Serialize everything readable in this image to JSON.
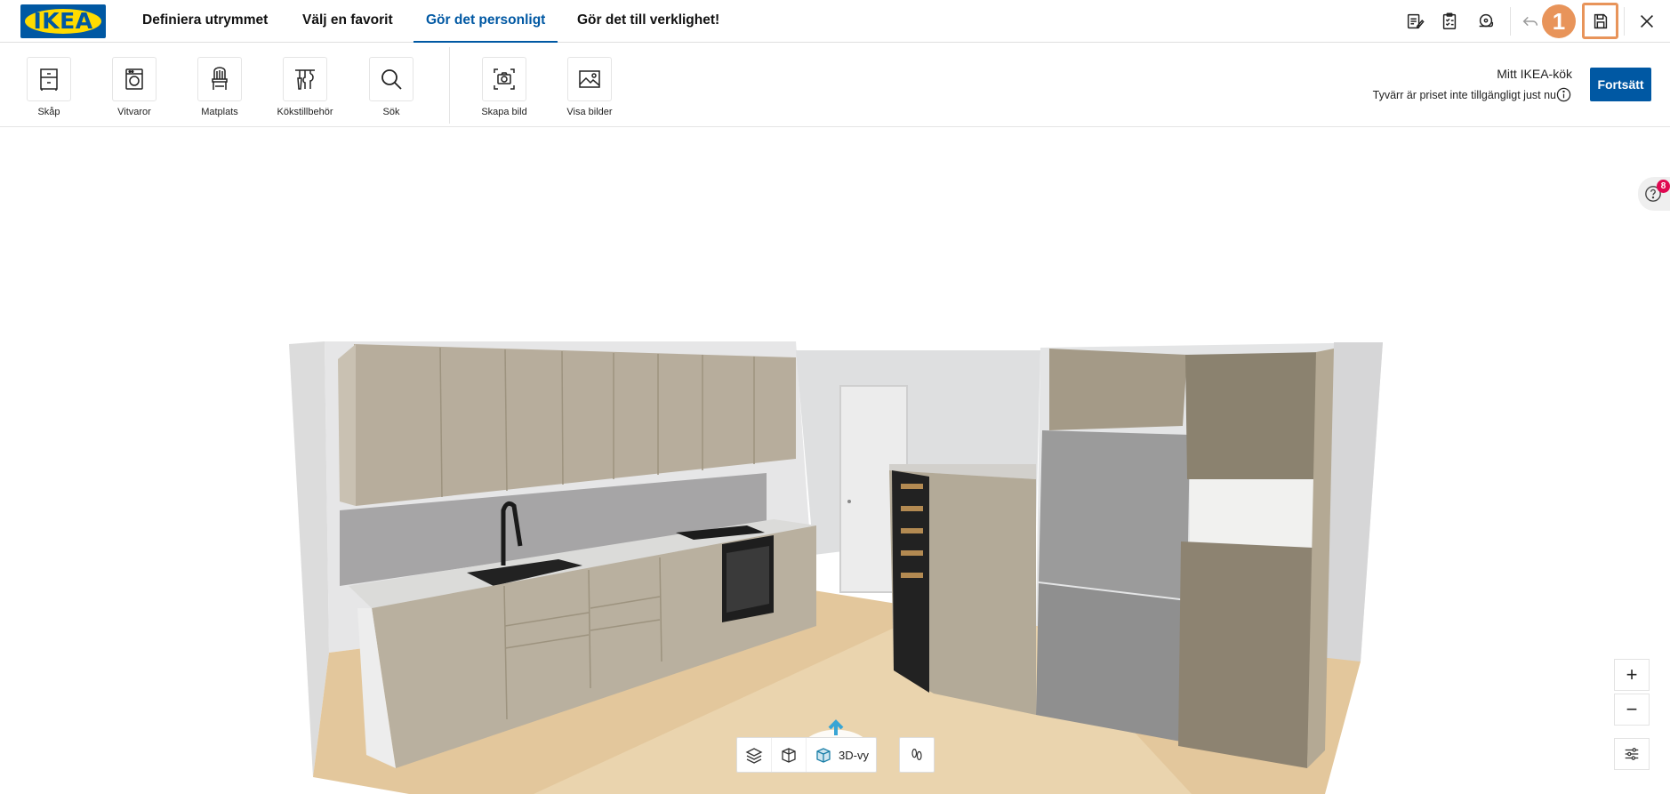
{
  "brand": {
    "logo_text": "IKEA",
    "blue": "#0058a3",
    "yellow": "#ffdb00"
  },
  "nav": {
    "tabs": [
      {
        "label": "Definiera utrymmet"
      },
      {
        "label": "Välj en favorit"
      },
      {
        "label": "Gör det personligt",
        "active": true
      },
      {
        "label": "Gör det till verklighet!"
      }
    ]
  },
  "top_actions": {
    "icons": [
      "notes-icon",
      "checklist-icon",
      "measure-icon",
      "undo-icon",
      "save-icon",
      "close-icon"
    ],
    "step_badge": "1",
    "highlight_color": "#e8945a"
  },
  "toolbar": {
    "tools": [
      {
        "label": "Skåp",
        "icon": "cabinet-icon"
      },
      {
        "label": "Vitvaror",
        "icon": "appliance-icon"
      },
      {
        "label": "Matplats",
        "icon": "chair-icon"
      },
      {
        "label": "Kökstillbehör",
        "icon": "utensils-icon"
      },
      {
        "label": "Sök",
        "icon": "search-icon"
      }
    ],
    "image_tools": [
      {
        "label": "Skapa bild",
        "icon": "camera-icon"
      },
      {
        "label": "Visa bilder",
        "icon": "image-icon"
      }
    ]
  },
  "summary": {
    "kitchen_name": "Mitt IKEA-kök",
    "price_note": "Tyvärr är priset inte tillgängligt just nu",
    "continue_label": "Fortsätt"
  },
  "canvas": {
    "help_badge": "8",
    "zoom_in": "+",
    "zoom_out": "−",
    "view_label": "3D-vy"
  }
}
